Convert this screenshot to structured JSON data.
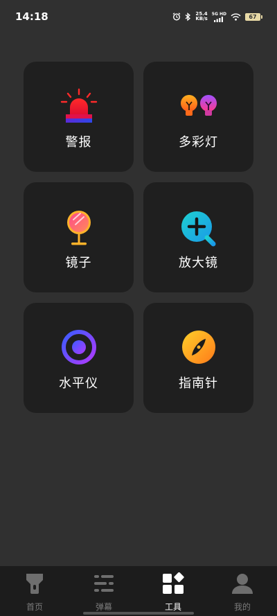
{
  "status": {
    "time": "14:18",
    "net_speed_value": "25.4",
    "net_speed_unit": "KB/s",
    "signal_label": "5G HD",
    "battery": "67"
  },
  "tools": [
    {
      "label": "警报",
      "icon": "alarm-siren-icon"
    },
    {
      "label": "多彩灯",
      "icon": "colorful-bulbs-icon"
    },
    {
      "label": "镜子",
      "icon": "mirror-icon"
    },
    {
      "label": "放大镜",
      "icon": "magnifier-icon"
    },
    {
      "label": "水平仪",
      "icon": "level-icon"
    },
    {
      "label": "指南针",
      "icon": "compass-icon"
    }
  ],
  "tabbar": {
    "items": [
      {
        "label": "首页",
        "icon": "flashlight-icon",
        "active": false
      },
      {
        "label": "弹幕",
        "icon": "barrage-icon",
        "active": false
      },
      {
        "label": "工具",
        "icon": "tools-grid-icon",
        "active": true
      },
      {
        "label": "我的",
        "icon": "profile-icon",
        "active": false
      }
    ]
  },
  "colors": {
    "background": "#303030",
    "tile": "#1f1f1f",
    "tabbar": "#1c1c1c",
    "tab_active": "#ffffff",
    "tab_inactive": "#7a7a7a"
  }
}
